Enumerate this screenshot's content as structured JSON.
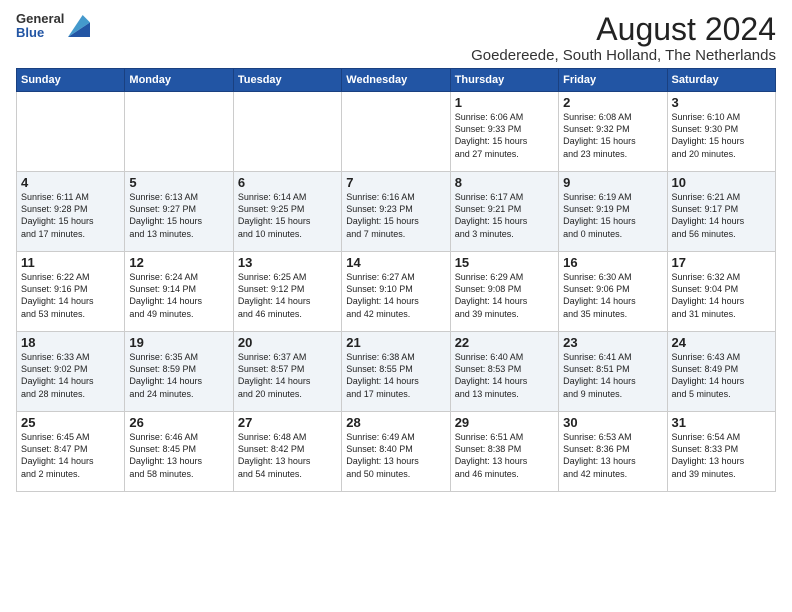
{
  "header": {
    "logo_general": "General",
    "logo_blue": "Blue",
    "month_year": "August 2024",
    "location": "Goedereede, South Holland, The Netherlands"
  },
  "days_of_week": [
    "Sunday",
    "Monday",
    "Tuesday",
    "Wednesday",
    "Thursday",
    "Friday",
    "Saturday"
  ],
  "weeks": [
    [
      {
        "day": "",
        "text": ""
      },
      {
        "day": "",
        "text": ""
      },
      {
        "day": "",
        "text": ""
      },
      {
        "day": "",
        "text": ""
      },
      {
        "day": "1",
        "text": "Sunrise: 6:06 AM\nSunset: 9:33 PM\nDaylight: 15 hours\nand 27 minutes."
      },
      {
        "day": "2",
        "text": "Sunrise: 6:08 AM\nSunset: 9:32 PM\nDaylight: 15 hours\nand 23 minutes."
      },
      {
        "day": "3",
        "text": "Sunrise: 6:10 AM\nSunset: 9:30 PM\nDaylight: 15 hours\nand 20 minutes."
      }
    ],
    [
      {
        "day": "4",
        "text": "Sunrise: 6:11 AM\nSunset: 9:28 PM\nDaylight: 15 hours\nand 17 minutes."
      },
      {
        "day": "5",
        "text": "Sunrise: 6:13 AM\nSunset: 9:27 PM\nDaylight: 15 hours\nand 13 minutes."
      },
      {
        "day": "6",
        "text": "Sunrise: 6:14 AM\nSunset: 9:25 PM\nDaylight: 15 hours\nand 10 minutes."
      },
      {
        "day": "7",
        "text": "Sunrise: 6:16 AM\nSunset: 9:23 PM\nDaylight: 15 hours\nand 7 minutes."
      },
      {
        "day": "8",
        "text": "Sunrise: 6:17 AM\nSunset: 9:21 PM\nDaylight: 15 hours\nand 3 minutes."
      },
      {
        "day": "9",
        "text": "Sunrise: 6:19 AM\nSunset: 9:19 PM\nDaylight: 15 hours\nand 0 minutes."
      },
      {
        "day": "10",
        "text": "Sunrise: 6:21 AM\nSunset: 9:17 PM\nDaylight: 14 hours\nand 56 minutes."
      }
    ],
    [
      {
        "day": "11",
        "text": "Sunrise: 6:22 AM\nSunset: 9:16 PM\nDaylight: 14 hours\nand 53 minutes."
      },
      {
        "day": "12",
        "text": "Sunrise: 6:24 AM\nSunset: 9:14 PM\nDaylight: 14 hours\nand 49 minutes."
      },
      {
        "day": "13",
        "text": "Sunrise: 6:25 AM\nSunset: 9:12 PM\nDaylight: 14 hours\nand 46 minutes."
      },
      {
        "day": "14",
        "text": "Sunrise: 6:27 AM\nSunset: 9:10 PM\nDaylight: 14 hours\nand 42 minutes."
      },
      {
        "day": "15",
        "text": "Sunrise: 6:29 AM\nSunset: 9:08 PM\nDaylight: 14 hours\nand 39 minutes."
      },
      {
        "day": "16",
        "text": "Sunrise: 6:30 AM\nSunset: 9:06 PM\nDaylight: 14 hours\nand 35 minutes."
      },
      {
        "day": "17",
        "text": "Sunrise: 6:32 AM\nSunset: 9:04 PM\nDaylight: 14 hours\nand 31 minutes."
      }
    ],
    [
      {
        "day": "18",
        "text": "Sunrise: 6:33 AM\nSunset: 9:02 PM\nDaylight: 14 hours\nand 28 minutes."
      },
      {
        "day": "19",
        "text": "Sunrise: 6:35 AM\nSunset: 8:59 PM\nDaylight: 14 hours\nand 24 minutes."
      },
      {
        "day": "20",
        "text": "Sunrise: 6:37 AM\nSunset: 8:57 PM\nDaylight: 14 hours\nand 20 minutes."
      },
      {
        "day": "21",
        "text": "Sunrise: 6:38 AM\nSunset: 8:55 PM\nDaylight: 14 hours\nand 17 minutes."
      },
      {
        "day": "22",
        "text": "Sunrise: 6:40 AM\nSunset: 8:53 PM\nDaylight: 14 hours\nand 13 minutes."
      },
      {
        "day": "23",
        "text": "Sunrise: 6:41 AM\nSunset: 8:51 PM\nDaylight: 14 hours\nand 9 minutes."
      },
      {
        "day": "24",
        "text": "Sunrise: 6:43 AM\nSunset: 8:49 PM\nDaylight: 14 hours\nand 5 minutes."
      }
    ],
    [
      {
        "day": "25",
        "text": "Sunrise: 6:45 AM\nSunset: 8:47 PM\nDaylight: 14 hours\nand 2 minutes."
      },
      {
        "day": "26",
        "text": "Sunrise: 6:46 AM\nSunset: 8:45 PM\nDaylight: 13 hours\nand 58 minutes."
      },
      {
        "day": "27",
        "text": "Sunrise: 6:48 AM\nSunset: 8:42 PM\nDaylight: 13 hours\nand 54 minutes."
      },
      {
        "day": "28",
        "text": "Sunrise: 6:49 AM\nSunset: 8:40 PM\nDaylight: 13 hours\nand 50 minutes."
      },
      {
        "day": "29",
        "text": "Sunrise: 6:51 AM\nSunset: 8:38 PM\nDaylight: 13 hours\nand 46 minutes."
      },
      {
        "day": "30",
        "text": "Sunrise: 6:53 AM\nSunset: 8:36 PM\nDaylight: 13 hours\nand 42 minutes."
      },
      {
        "day": "31",
        "text": "Sunrise: 6:54 AM\nSunset: 8:33 PM\nDaylight: 13 hours\nand 39 minutes."
      }
    ]
  ]
}
